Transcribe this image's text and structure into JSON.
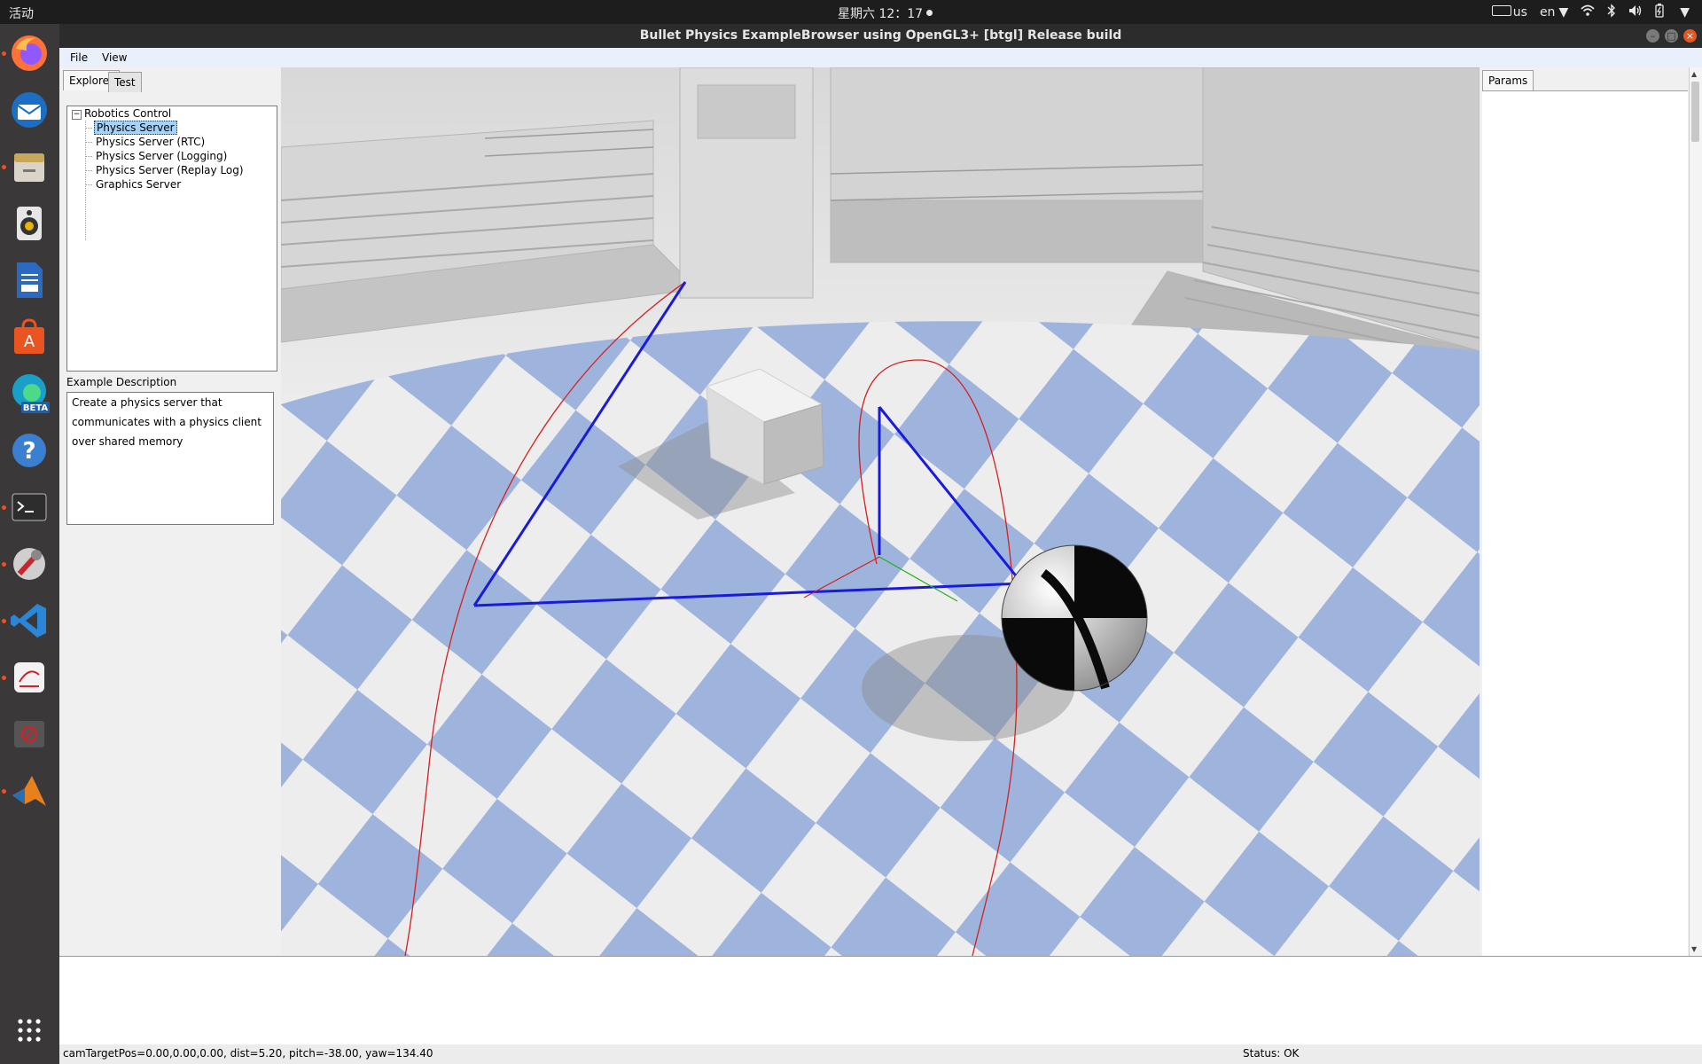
{
  "topbar": {
    "activities": "活动",
    "clock": "星期六 12：17",
    "keyboard": "us",
    "language": "en"
  },
  "dock": {
    "items": [
      {
        "name": "firefox",
        "icon": "firefox-icon",
        "color": "#ff7139",
        "running": true
      },
      {
        "name": "thunderbird",
        "icon": "mail-icon",
        "color": "#2a7fd4",
        "running": false
      },
      {
        "name": "files",
        "icon": "files-icon",
        "color": "#c8a75a",
        "running": true
      },
      {
        "name": "rhythmbox",
        "icon": "speaker-icon",
        "color": "#e8b400",
        "running": false
      },
      {
        "name": "writer",
        "icon": "document-icon",
        "color": "#2a6bc1",
        "running": false
      },
      {
        "name": "software",
        "icon": "store-icon",
        "color": "#e95420",
        "running": false
      },
      {
        "name": "edge-beta",
        "icon": "edge-icon",
        "color": "#1aa0c8",
        "running": false
      },
      {
        "name": "help",
        "icon": "help-icon",
        "color": "#3b7fd1",
        "running": false
      },
      {
        "name": "terminal",
        "icon": "terminal-icon",
        "color": "#2d2d2d",
        "running": true
      },
      {
        "name": "tweaks",
        "icon": "wrench-icon",
        "color": "#d9d9d9",
        "running": true
      },
      {
        "name": "vscode",
        "icon": "vscode-icon",
        "color": "#2b86d7",
        "running": true
      },
      {
        "name": "editor",
        "icon": "pen-icon",
        "color": "#c8252c",
        "running": true
      },
      {
        "name": "blocked-app",
        "icon": "blocked-icon",
        "color": "#c8252c",
        "running": false
      },
      {
        "name": "matlab",
        "icon": "matlab-icon",
        "color": "#e8801e",
        "running": true
      }
    ],
    "beta_label": "BETA",
    "apps_grid": "apps-grid-icon"
  },
  "window": {
    "title": "Bullet Physics ExampleBrowser using OpenGL3+ [btgl] Release build"
  },
  "menu": {
    "file": "File",
    "view": "View"
  },
  "explorer": {
    "tab_explorer": "Explorer",
    "tab_test": "Test",
    "root": "Robotics Control",
    "items": [
      {
        "label": "Physics Server",
        "selected": true
      },
      {
        "label": "Physics Server (RTC)",
        "selected": false
      },
      {
        "label": "Physics Server (Logging)",
        "selected": false
      },
      {
        "label": "Physics Server (Replay Log)",
        "selected": false
      },
      {
        "label": "Graphics Server",
        "selected": false
      }
    ],
    "description_title": "Example Description",
    "description_lines": [
      "Create a physics server that",
      "communicates with a physics client",
      "over shared memory"
    ]
  },
  "params": {
    "tab": "Params"
  },
  "status": {
    "camera": "camTargetPos=0.00,0.00,0.00, dist=5.20, pitch=-38.00, yaw=134.40",
    "state": "Status: OK"
  },
  "scene": {
    "floor_blue": "#9fb4dc",
    "floor_white": "#eeeeee",
    "path_color": "#d42020",
    "link_color": "#1a1adb"
  }
}
